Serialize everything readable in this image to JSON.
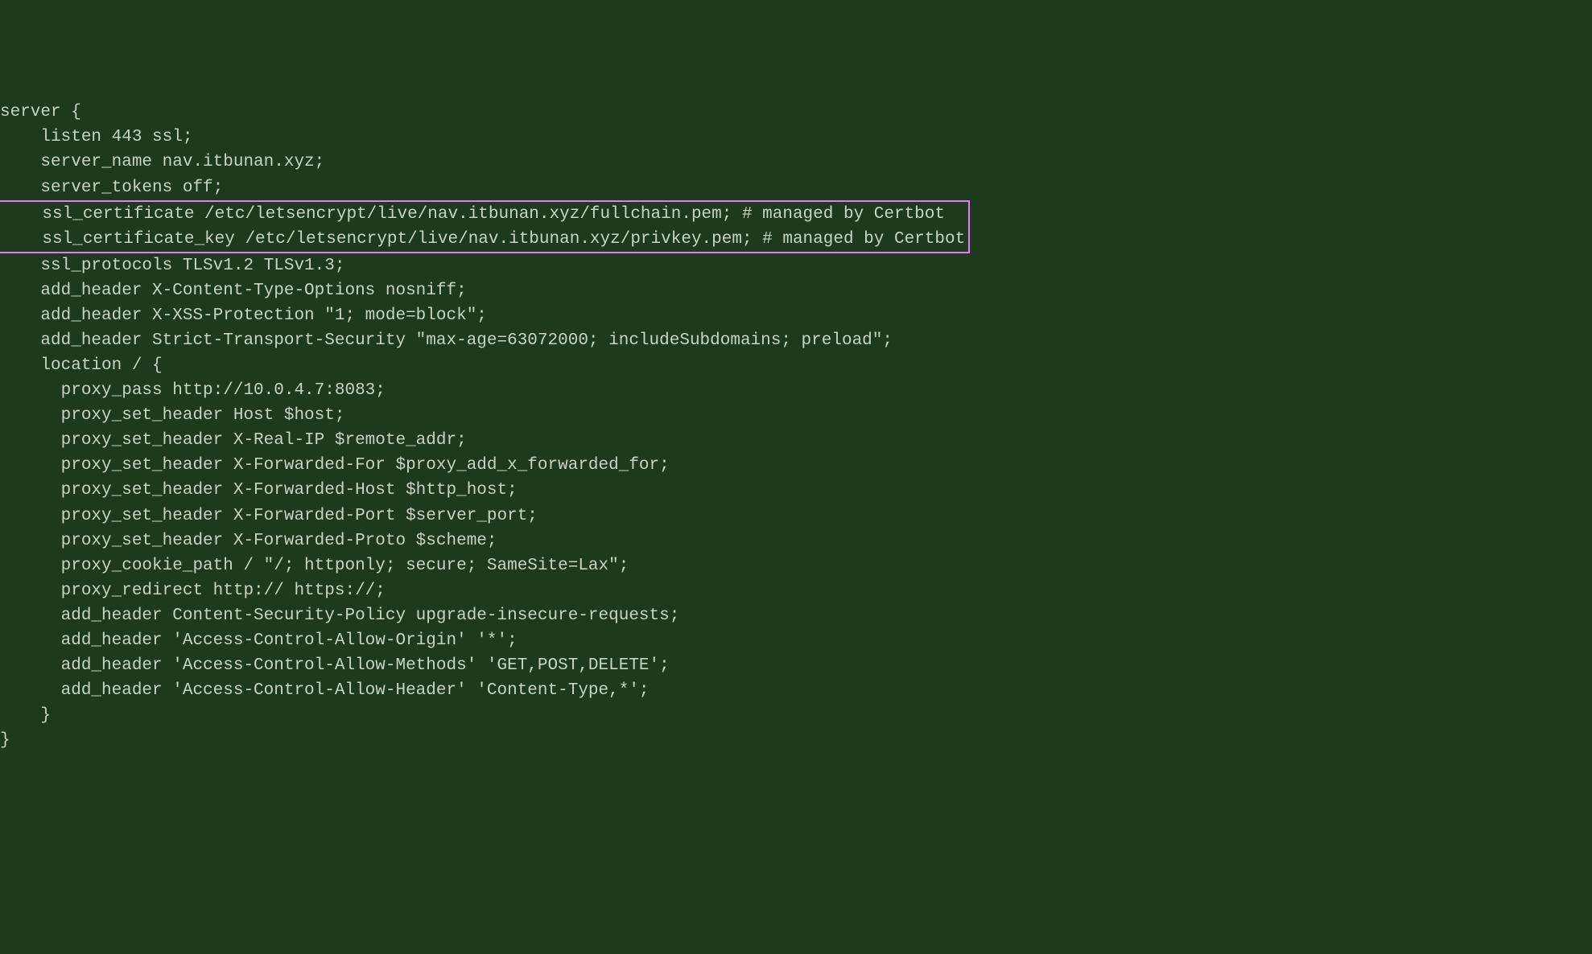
{
  "lines": {
    "l0": "server {",
    "l1": "    listen 443 ssl;",
    "l2": "    server_name nav.itbunan.xyz;",
    "l3": "    server_tokens off;",
    "l4": "    ssl_certificate /etc/letsencrypt/live/nav.itbunan.xyz/fullchain.pem; # managed by Certbot",
    "l5": "    ssl_certificate_key /etc/letsencrypt/live/nav.itbunan.xyz/privkey.pem; # managed by Certbot",
    "l6": "    ssl_protocols TLSv1.2 TLSv1.3;",
    "l7": "    add_header X-Content-Type-Options nosniff;",
    "l8": "    add_header X-XSS-Protection \"1; mode=block\";",
    "l9": "    add_header Strict-Transport-Security \"max-age=63072000; includeSubdomains; preload\";",
    "l10": "    location / {",
    "l11": "      proxy_pass http://10.0.4.7:8083;",
    "l12": "      proxy_set_header Host $host;",
    "l13": "      proxy_set_header X-Real-IP $remote_addr;",
    "l14": "      proxy_set_header X-Forwarded-For $proxy_add_x_forwarded_for;",
    "l15": "      proxy_set_header X-Forwarded-Host $http_host;",
    "l16": "      proxy_set_header X-Forwarded-Port $server_port;",
    "l17": "      proxy_set_header X-Forwarded-Proto $scheme;",
    "l18": "      proxy_cookie_path / \"/; httponly; secure; SameSite=Lax\";",
    "l19": "      proxy_redirect http:// https://;",
    "l20": "      add_header Content-Security-Policy upgrade-insecure-requests;",
    "l21": "      add_header 'Access-Control-Allow-Origin' '*';",
    "l22": "      add_header 'Access-Control-Allow-Methods' 'GET,POST,DELETE';",
    "l23": "      add_header 'Access-Control-Allow-Header' 'Content-Type,*';",
    "l24": "    }",
    "l25": "",
    "l26": "}"
  }
}
